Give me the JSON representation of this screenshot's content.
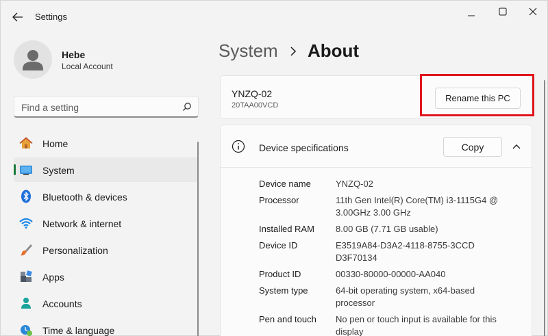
{
  "window": {
    "title": "Settings"
  },
  "profile": {
    "name": "Hebe",
    "account_type": "Local Account"
  },
  "search": {
    "placeholder": "Find a setting"
  },
  "sidebar": {
    "items": [
      {
        "label": "Home",
        "icon": "home-icon",
        "selected": false
      },
      {
        "label": "System",
        "icon": "system-icon",
        "selected": true
      },
      {
        "label": "Bluetooth & devices",
        "icon": "bluetooth-icon",
        "selected": false
      },
      {
        "label": "Network & internet",
        "icon": "wifi-icon",
        "selected": false
      },
      {
        "label": "Personalization",
        "icon": "brush-icon",
        "selected": false
      },
      {
        "label": "Apps",
        "icon": "apps-icon",
        "selected": false
      },
      {
        "label": "Accounts",
        "icon": "accounts-icon",
        "selected": false
      },
      {
        "label": "Time & language",
        "icon": "time-language-icon",
        "selected": false
      }
    ]
  },
  "breadcrumb": {
    "parent": "System",
    "current": "About"
  },
  "pc": {
    "name": "YNZQ-02",
    "model": "20TAA00VCD",
    "rename_label": "Rename this PC"
  },
  "device_specs": {
    "title": "Device specifications",
    "copy_label": "Copy",
    "rows": [
      {
        "label": "Device name",
        "value": "YNZQ-02"
      },
      {
        "label": "Processor",
        "value": "11th Gen Intel(R) Core(TM) i3-1115G4 @ 3.00GHz   3.00 GHz"
      },
      {
        "label": "Installed RAM",
        "value": "8.00 GB (7.71 GB usable)"
      },
      {
        "label": "Device ID",
        "value": "E3519A84-D3A2-4118-8755-3CCDD3F70134"
      },
      {
        "label": "Product ID",
        "value": "00330-80000-00000-AA040"
      },
      {
        "label": "System type",
        "value": "64-bit operating system, x64-based processor"
      },
      {
        "label": "Pen and touch",
        "value": "No pen or touch input is available for this display"
      }
    ]
  },
  "colors": {
    "accent": "#1a7a3b",
    "highlight": "#e1141c"
  }
}
